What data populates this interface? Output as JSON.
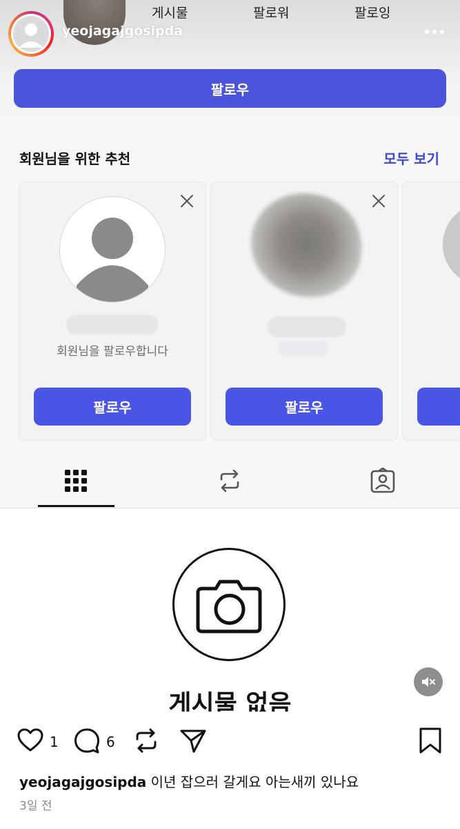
{
  "profile": {
    "username": "yeojagajgosipda",
    "stats": {
      "posts_label": "게시물",
      "followers_label": "팔로워",
      "following_label": "팔로잉"
    },
    "follow_label": "팔로우"
  },
  "suggestions": {
    "title": "회원님을 위한 추천",
    "see_all": "모두 보기",
    "cards": [
      {
        "subtitle": "회원님을 팔로우합니다",
        "follow_label": "팔로우"
      },
      {
        "subtitle": "",
        "follow_label": "팔로우"
      }
    ]
  },
  "tabs": [
    {
      "icon": "grid-icon",
      "active": true
    },
    {
      "icon": "repost-icon",
      "active": false
    },
    {
      "icon": "tagged-icon",
      "active": false
    }
  ],
  "empty_state": {
    "icon": "camera-icon",
    "title": "게시물 없음"
  },
  "post": {
    "likes": "1",
    "comments": "6",
    "caption_user": "yeojagajgosipda",
    "caption_text": "이년 잡으러 갈게요 아는새끼 있나요",
    "time": "3일 전"
  },
  "colors": {
    "accent": "#4a55e6",
    "link": "#3b47d6"
  }
}
